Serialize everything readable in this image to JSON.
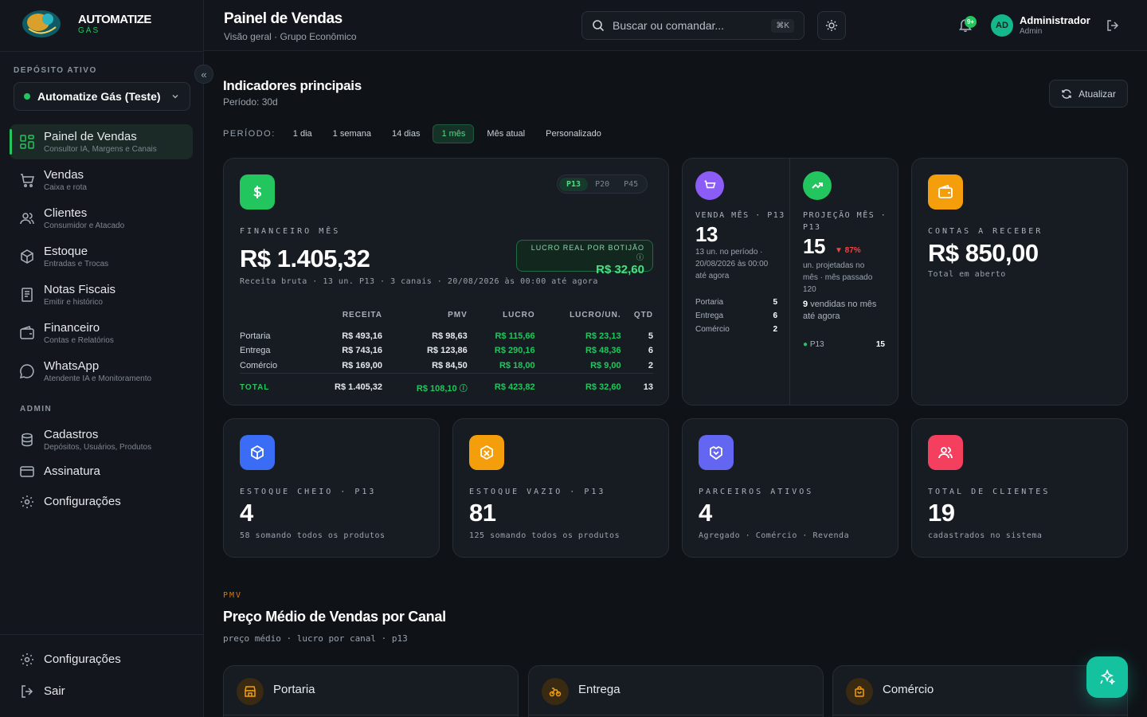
{
  "brand": {
    "name": "AUTOMATIZE",
    "sub": "GÁS"
  },
  "sidebar": {
    "depot_label": "DEPÓSITO ATIVO",
    "depot_value": "Automatize Gás (Teste)",
    "items": [
      {
        "title": "Painel de Vendas",
        "sub": "Consultor IA, Margens e Canais"
      },
      {
        "title": "Vendas",
        "sub": "Caixa e rota"
      },
      {
        "title": "Clientes",
        "sub": "Consumidor e Atacado"
      },
      {
        "title": "Estoque",
        "sub": "Entradas e Trocas"
      },
      {
        "title": "Notas Fiscais",
        "sub": "Emitir e histórico"
      },
      {
        "title": "Financeiro",
        "sub": "Contas e Relatórios"
      },
      {
        "title": "WhatsApp",
        "sub": "Atendente IA e Monitoramento"
      }
    ],
    "admin_label": "ADMIN",
    "admin_items": [
      {
        "title": "Cadastros",
        "sub": "Depósitos, Usuários, Produtos"
      },
      {
        "title": "Assinatura"
      },
      {
        "title": "Configurações"
      }
    ],
    "bottom": {
      "settings": "Configurações",
      "logout": "Sair"
    }
  },
  "topbar": {
    "title": "Painel de Vendas",
    "subtitle": "Visão geral · Grupo Econômico",
    "search_placeholder": "Buscar ou comandar...",
    "shortcut": "⌘K",
    "notif_badge": "9+",
    "user": {
      "initials": "AD",
      "name": "Administrador",
      "role": "Admin"
    }
  },
  "section": {
    "title": "Indicadores principais",
    "subtitle": "Período: 30d",
    "refresh": "Atualizar",
    "period_label": "PERÍODO:",
    "periods": [
      "1 dia",
      "1 semana",
      "14 dias",
      "1 mês",
      "Mês atual",
      "Personalizado"
    ],
    "active_period": "1 mês"
  },
  "financeiro": {
    "label": "FINANCEIRO MÊS",
    "value": "R$ 1.405,32",
    "subline": "Receita bruta · 13 un. P13 · 3 canais · 20/08/2026 às 00:00 até agora",
    "segments": [
      "P13",
      "P20",
      "P45"
    ],
    "active_segment": "P13",
    "lucro_label": "LUCRO REAL POR BOTIJÃO",
    "lucro_value": "R$ 32,60",
    "headers": [
      "",
      "RECEITA",
      "PMV",
      "LUCRO",
      "LUCRO/UN.",
      "QTD"
    ],
    "rows": [
      [
        "Portaria",
        "R$ 493,16",
        "R$ 98,63",
        "R$ 115,66",
        "R$ 23,13",
        "5"
      ],
      [
        "Entrega",
        "R$ 743,16",
        "R$ 123,86",
        "R$ 290,16",
        "R$ 48,36",
        "6"
      ],
      [
        "Comércio",
        "R$ 169,00",
        "R$ 84,50",
        "R$ 18,00",
        "R$ 9,00",
        "2"
      ]
    ],
    "total": [
      "TOTAL",
      "R$ 1.405,32",
      "R$ 108,10",
      "R$ 423,82",
      "R$ 32,60",
      "13"
    ]
  },
  "venda_mes": {
    "label": "VENDA MÊS · P13",
    "value": "13",
    "sub1": "13 un. no período ·",
    "sub2": "20/08/2026 às 00:00",
    "sub3": "até agora",
    "rows": [
      [
        "Portaria",
        "5"
      ],
      [
        "Entrega",
        "6"
      ],
      [
        "Comércio",
        "2"
      ]
    ]
  },
  "projecao": {
    "label1": "PROJEÇÃO MÊS ·",
    "label2": "P13",
    "value": "15",
    "delta": "▼ 87%",
    "sub1": "un. projetadas no",
    "sub2": "mês · mês passado",
    "sub3": "120",
    "sold_num": "9",
    "sold1": "vendidas no mês",
    "sold2": "até agora",
    "row": [
      "P13",
      "15"
    ]
  },
  "receber": {
    "label": "CONTAS A RECEBER",
    "value": "R$ 850,00",
    "sub": "Total em aberto"
  },
  "kpis": [
    {
      "label": "ESTOQUE CHEIO · P13",
      "value": "4",
      "sub": "58 somando todos os produtos",
      "color": "#3b6cf6"
    },
    {
      "label": "ESTOQUE VAZIO · P13",
      "value": "81",
      "sub": "125 somando todos os produtos",
      "color": "#f59e0b"
    },
    {
      "label": "PARCEIROS ATIVOS",
      "value": "4",
      "sub": "Agregado · Comércio · Revenda",
      "color": "#6366f1"
    },
    {
      "label": "TOTAL DE CLIENTES",
      "value": "19",
      "sub": "cadastrados no sistema",
      "color": "#f43f5e"
    }
  ],
  "pmv": {
    "tag": "PMV",
    "title": "Preço Médio de Vendas por Canal",
    "subtitle": "preço médio · lucro por canal · p13",
    "channels": [
      "Portaria",
      "Entrega",
      "Comércio"
    ]
  },
  "colors": {
    "accent": "#22c55e",
    "danger": "#ef4444",
    "bg": "#0f1318"
  }
}
